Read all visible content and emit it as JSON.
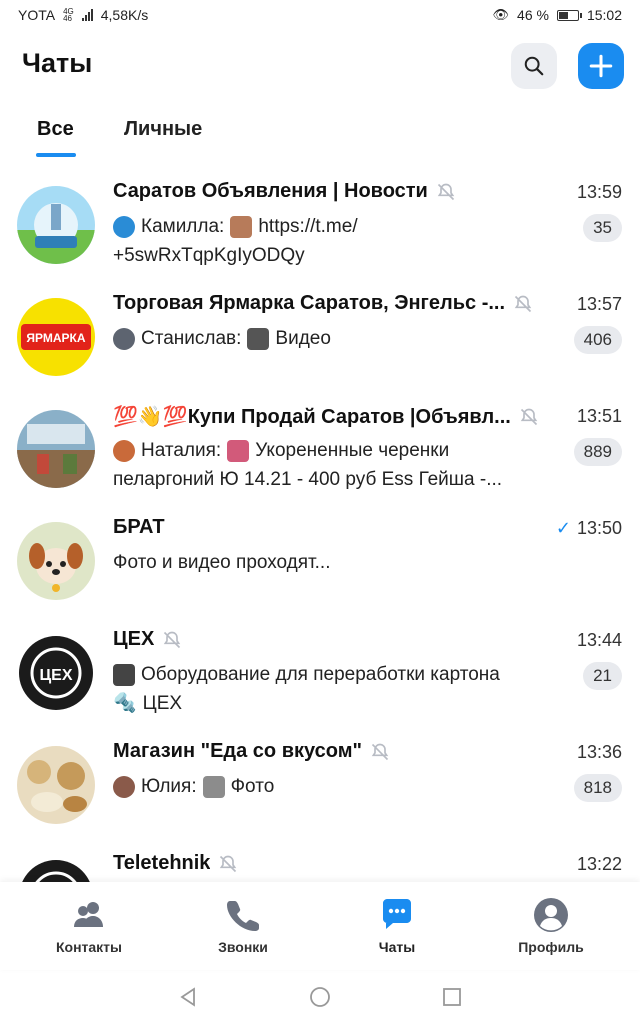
{
  "status_bar": {
    "carrier": "YOTA",
    "network_tag_top": "4G",
    "network_tag_bottom": "46",
    "speed": "4,58K/s",
    "battery": "46 %",
    "time": "15:02"
  },
  "header": {
    "title": "Чаты",
    "search_icon": "search-icon",
    "add_icon": "plus-icon"
  },
  "tabs": [
    {
      "label": "Все",
      "active": true
    },
    {
      "label": "Личные",
      "active": false
    }
  ],
  "chats": [
    {
      "title": "Саратов Объявления | Новости",
      "muted": true,
      "time": "13:59",
      "sender": "Камилла:",
      "line1": "https://t.me/",
      "line2": "+5swRxTqpKgIyODQy",
      "badge": "35"
    },
    {
      "title": "Торговая Ярмарка Саратов, Энгельс -...",
      "muted": true,
      "time": "13:57",
      "sender": "Станислав:",
      "line1": "Видео",
      "badge": "406",
      "avatar_text": "ЯРМАРКА"
    },
    {
      "title": "💯👋💯Купи Продай Саратов |Объявл...",
      "muted": true,
      "time": "13:51",
      "sender": "Наталия:",
      "line1": "Укорененные черенки",
      "line2": "пеларгоний Ю 14.21 - 400 руб Ess Гейша -...",
      "badge": "889"
    },
    {
      "title": "БРАТ",
      "muted": false,
      "time": "13:50",
      "read": true,
      "line1": "Фото и видео проходят..."
    },
    {
      "title": "ЦЕХ",
      "muted": true,
      "time": "13:44",
      "line1": "Оборудование для переработки картона",
      "line2": "ЦЕХ",
      "badge": "21",
      "avatar_text": "ЦЕХ"
    },
    {
      "title": "Магазин \"Еда со вкусом\"",
      "muted": true,
      "time": "13:36",
      "sender": "Юлия:",
      "line1": "Фото",
      "badge": "818"
    },
    {
      "title": "Teletehnik",
      "muted": true,
      "time": "13:22"
    }
  ],
  "bottom_nav": [
    {
      "label": "Контакты",
      "icon": "contacts-icon",
      "active": false
    },
    {
      "label": "Звонки",
      "icon": "phone-icon",
      "active": false
    },
    {
      "label": "Чаты",
      "icon": "chat-bubble-icon",
      "active": true
    },
    {
      "label": "Профиль",
      "icon": "profile-icon",
      "active": false
    }
  ],
  "colors": {
    "accent": "#1a8cf0",
    "badge_bg": "#e8eaee",
    "muted_gray": "#b8bcc4"
  }
}
